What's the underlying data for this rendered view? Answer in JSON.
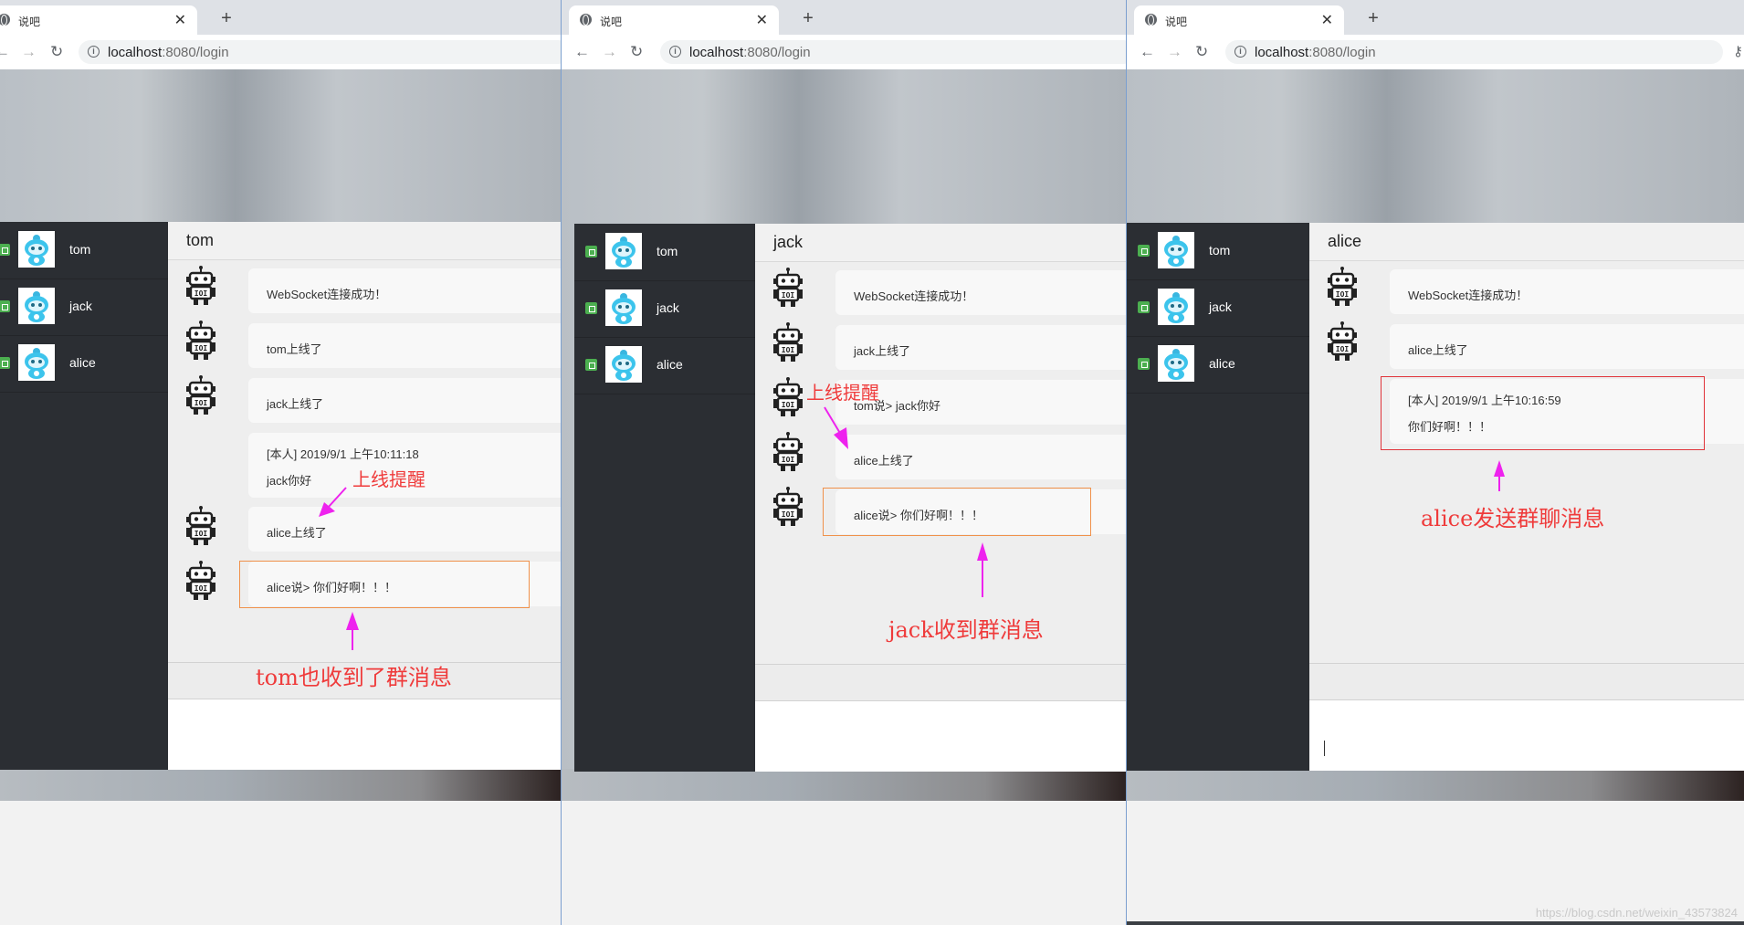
{
  "browser": {
    "tab_title": "说吧",
    "url_host": "localhost",
    "url_rest": ":8080/login"
  },
  "contacts": [
    "tom",
    "jack",
    "alice"
  ],
  "windows": [
    {
      "user": "tom",
      "messages": [
        {
          "text": "WebSocket连接成功！"
        },
        {
          "text": "tom上线了"
        },
        {
          "text": "jack上线了"
        },
        {
          "line1": "[本人] 2019/9/1 上午10:11:18",
          "line2": "jack你好"
        },
        {
          "text": "alice上线了"
        },
        {
          "text": "alice说> 你们好啊！！！"
        }
      ],
      "annotations": [
        "上线提醒",
        "tom也收到了群消息"
      ]
    },
    {
      "user": "jack",
      "messages": [
        {
          "text": "WebSocket连接成功！"
        },
        {
          "text": "jack上线了"
        },
        {
          "text": "tom说> jack你好"
        },
        {
          "text": "alice上线了"
        },
        {
          "text": "alice说> 你们好啊！！！"
        }
      ],
      "annotations": [
        "上线提醒",
        "jack收到群消息"
      ]
    },
    {
      "user": "alice",
      "messages": [
        {
          "text": "WebSocket连接成功！"
        },
        {
          "text": "alice上线了"
        },
        {
          "line1": "[本人] 2019/9/1 上午10:16:59",
          "line2": "你们好啊！！！"
        }
      ],
      "annotations": [
        "alice发送群聊消息"
      ]
    }
  ],
  "watermark": "https://blog.csdn.net/weixin_43573824",
  "colors": {
    "annotation_red": "#ef3b3b",
    "arrow_magenta": "#ee22ee",
    "online_green": "#4caf50",
    "sidebar": "#2b2e33"
  }
}
